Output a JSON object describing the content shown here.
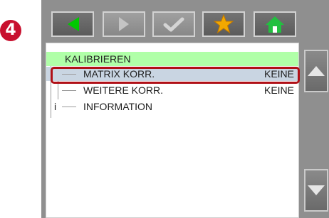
{
  "step_badge": "4",
  "toolbar": {
    "buttons": [
      {
        "icon": "arrow-left-icon",
        "color": "#00c800",
        "state": "active"
      },
      {
        "icon": "arrow-right-icon",
        "color": "#bdbdbd",
        "state": "disabled"
      },
      {
        "icon": "checkmark-icon",
        "color": "#cfcfcf",
        "state": "disabled"
      },
      {
        "icon": "star-icon",
        "color": "#f2a800",
        "state": "active"
      },
      {
        "icon": "home-icon",
        "color": "#22c040",
        "state": "active"
      }
    ]
  },
  "menu": {
    "header": "KALIBRIEREN",
    "items": [
      {
        "label": "MATRIX KORR.",
        "value": "KEINE",
        "selected": true
      },
      {
        "label": "WEITERE KORR.",
        "value": "KEINE",
        "selected": false
      },
      {
        "label": "INFORMATION",
        "value": "",
        "prefix": "i",
        "selected": false
      }
    ]
  },
  "scroll": {
    "up_icon": "triangle-up-icon",
    "down_icon": "triangle-down-icon"
  },
  "colors": {
    "header_bg": "#b0ffa8",
    "selected_bg": "#c9d5e2",
    "highlight_border": "#b01017",
    "badge_bg": "#c8102e"
  }
}
